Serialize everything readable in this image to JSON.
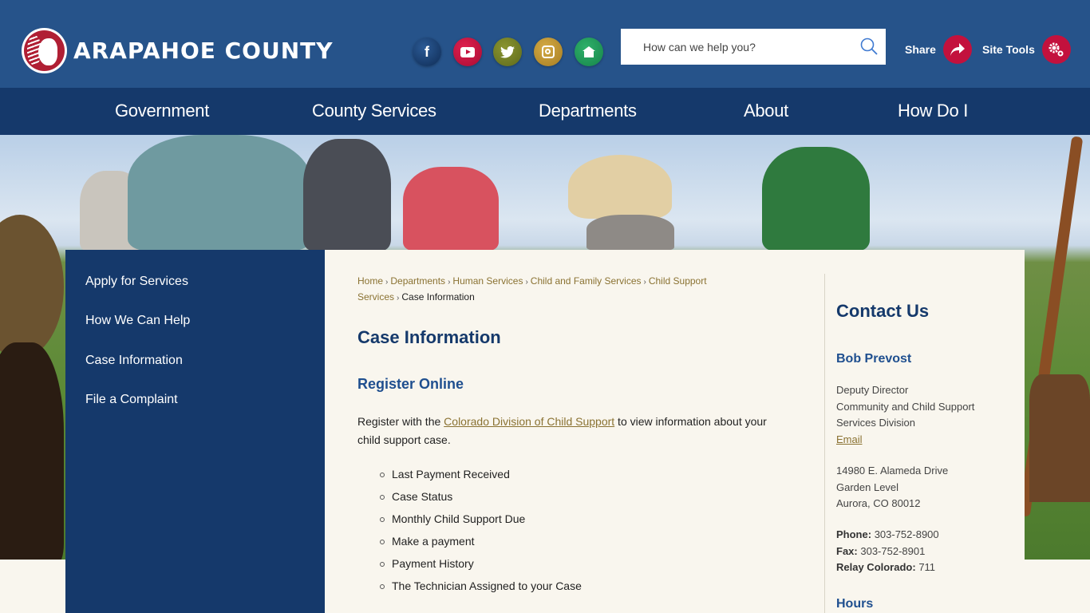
{
  "header": {
    "logo_text": "ARAPAHOE COUNTY",
    "social": [
      {
        "name": "facebook",
        "glyph": "f",
        "color": "#1d4477"
      },
      {
        "name": "youtube",
        "glyph": "▶",
        "color": "#c3113d"
      },
      {
        "name": "twitter",
        "glyph": "🐦",
        "color": "#6e7a22"
      },
      {
        "name": "instagram",
        "glyph": "◎",
        "color": "#b8922e"
      },
      {
        "name": "nextdoor",
        "glyph": "⌂",
        "color": "#1f9a58"
      }
    ],
    "search": {
      "placeholder": "How can we help you?",
      "value": ""
    },
    "share_label": "Share",
    "site_tools_label": "Site Tools"
  },
  "nav": {
    "items": [
      {
        "label": "Government"
      },
      {
        "label": "County Services"
      },
      {
        "label": "Departments"
      },
      {
        "label": "About"
      },
      {
        "label": "How Do I"
      }
    ]
  },
  "sidebar": {
    "items": [
      {
        "label": "Apply for Services"
      },
      {
        "label": "How We Can Help"
      },
      {
        "label": "Case Information"
      },
      {
        "label": "File a Complaint"
      }
    ]
  },
  "breadcrumb": {
    "items": [
      "Home",
      "Departments",
      "Human Services",
      "Child and Family Services",
      "Child Support Services"
    ],
    "current": "Case Information"
  },
  "main": {
    "title": "Case Information",
    "subheading": "Register Online",
    "para_before": "Register with the ",
    "para_link": "Colorado Division of Child Support",
    "para_after": " to view information about your child support case.",
    "bullets": [
      "Last Payment Received",
      "Case Status",
      "Monthly Child Support Due",
      "Make a payment",
      "Payment History",
      "The Technician Assigned to your Case"
    ]
  },
  "contact": {
    "title": "Contact Us",
    "name": "Bob Prevost",
    "role": "Deputy Director",
    "division_1": "Community and Child Support",
    "division_2": "Services Division",
    "email_label": "Email",
    "address_1": "14980 E. Alameda Drive",
    "address_2": "Garden Level",
    "address_3": "Aurora, CO 80012",
    "phone_label": "Phone:",
    "phone": "303-752-8900",
    "fax_label": "Fax:",
    "fax": "303-752-8901",
    "relay_label": "Relay Colorado:",
    "relay": "711",
    "hours_title": "Hours"
  }
}
